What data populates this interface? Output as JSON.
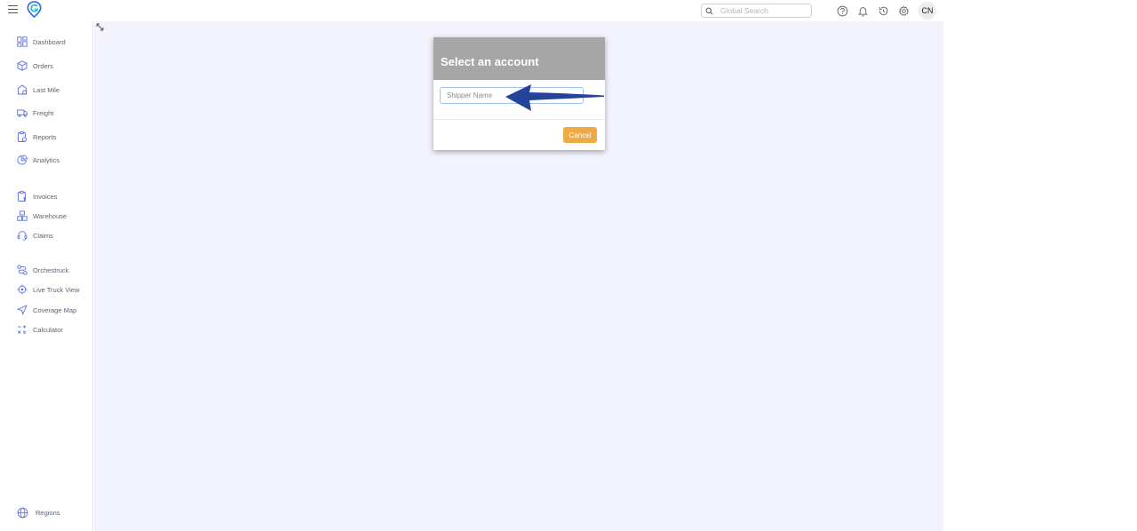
{
  "topbar": {
    "search_placeholder": "Global Search",
    "avatar_initials": "CN",
    "icons": [
      "help-icon",
      "bell-icon",
      "history-icon",
      "gear-icon"
    ]
  },
  "sidebar": {
    "items": [
      {
        "label": "Dashboard",
        "icon": "dashboard-icon"
      },
      {
        "label": "Orders",
        "icon": "box-icon"
      },
      {
        "label": "Last Mile",
        "icon": "last-mile-icon"
      },
      {
        "label": "Freight",
        "icon": "truck-icon"
      },
      {
        "label": "Reports",
        "icon": "reports-icon"
      },
      {
        "label": "Analytics",
        "icon": "analytics-icon"
      },
      {
        "label": "Invoices",
        "icon": "invoice-icon"
      },
      {
        "label": "Warehouse",
        "icon": "warehouse-icon"
      },
      {
        "label": "Claims",
        "icon": "headset-icon"
      },
      {
        "label": "Orchestruck",
        "icon": "route-icon"
      },
      {
        "label": "Live Truck View",
        "icon": "target-icon"
      },
      {
        "label": "Coverage Map",
        "icon": "navigation-icon"
      },
      {
        "label": "Calculator",
        "icon": "calculator-icon"
      }
    ],
    "footer": {
      "label": "Regions",
      "icon": "globe-icon"
    }
  },
  "modal": {
    "title": "Select an account",
    "shipper_placeholder": "Shipper Name",
    "cancel_label": "Cancel"
  },
  "colors": {
    "accent": "#5b6ee1",
    "modal_header": "#a6a6a6",
    "cancel_button": "#efaa48",
    "main_bg": "#f3f3fd",
    "arrow": "#23449a"
  }
}
